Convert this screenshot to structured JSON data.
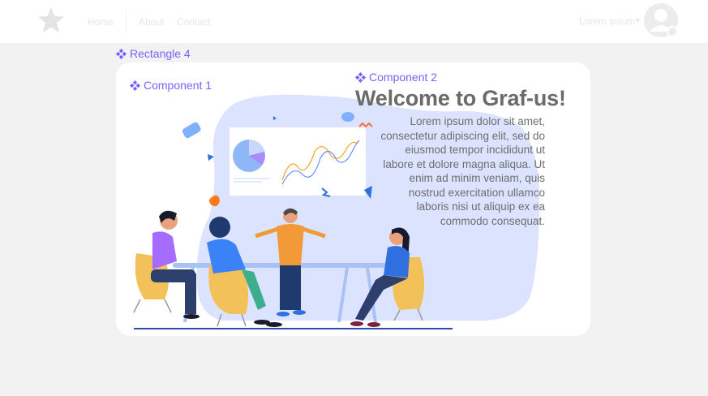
{
  "nav": {
    "logo_icon": "star-icon",
    "links": [
      "Home",
      "About",
      "Contact"
    ],
    "user_name": "Lorem ipsum",
    "caret_icon": "chevron-down-icon",
    "avatar_icon": "user-avatar-icon"
  },
  "labels": {
    "rectangle": "Rectangle 4",
    "component1": "Component 1",
    "component2": "Component 2"
  },
  "hero": {
    "title": "Welcome to Graf-us!",
    "body": "Lorem ipsum dolor sit amet, consectetur adipiscing elit, sed do eiusmod tempor incididunt ut labore et dolore magna aliqua. Ut enim ad minim veniam, quis nostrud exercitation ullamco laboris nisi ut aliquip ex ea commodo consequat."
  },
  "colors": {
    "accent_purple": "#7b61ff",
    "blob_blue": "#dbe3ff",
    "background": "#f2f2f2",
    "card": "#ffffff"
  }
}
